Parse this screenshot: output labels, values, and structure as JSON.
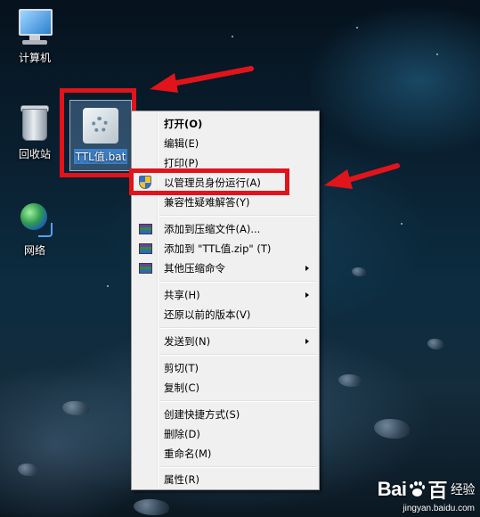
{
  "desktop": {
    "icons": [
      {
        "label": "计算机"
      },
      {
        "label": "回收站"
      },
      {
        "label": "网络"
      }
    ],
    "selected_file": {
      "label": "TTL值.bat"
    }
  },
  "context_menu": {
    "items": [
      {
        "label": "打开(O)",
        "bold": true
      },
      {
        "label": "编辑(E)"
      },
      {
        "label": "打印(P)"
      },
      {
        "label": "以管理员身份运行(A)",
        "icon": "uac-shield-icon"
      },
      {
        "label": "兼容性疑难解答(Y)"
      },
      {
        "label": "添加到压缩文件(A)...",
        "icon": "archive-icon"
      },
      {
        "label": "添加到 \"TTL值.zip\" (T)",
        "icon": "archive-icon"
      },
      {
        "label": "其他压缩命令",
        "icon": "archive-icon",
        "submenu": true
      },
      {
        "label": "共享(H)",
        "submenu": true
      },
      {
        "label": "还原以前的版本(V)"
      },
      {
        "label": "发送到(N)",
        "submenu": true
      },
      {
        "label": "剪切(T)"
      },
      {
        "label": "复制(C)"
      },
      {
        "label": "创建快捷方式(S)"
      },
      {
        "label": "删除(D)"
      },
      {
        "label": "重命名(M)"
      },
      {
        "label": "属性(R)"
      }
    ]
  },
  "annotations": {
    "highlight_color": "#e0141a"
  },
  "watermark": {
    "brand_left": "Bai",
    "brand_right": "百",
    "suffix": "经验",
    "url": "jingyan.baidu.com"
  }
}
